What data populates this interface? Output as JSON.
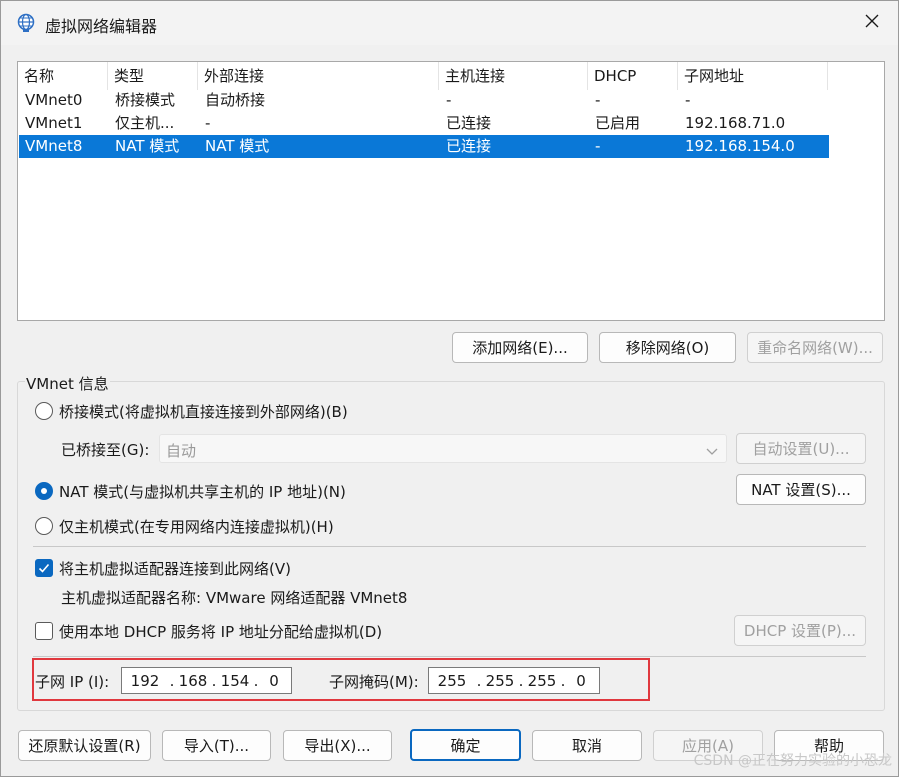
{
  "window": {
    "title": "虚拟网络编辑器",
    "title_icon": "globe-network-icon",
    "close_icon": "close-icon"
  },
  "network_list": {
    "columns": [
      "名称",
      "类型",
      "外部连接",
      "主机连接",
      "DHCP",
      "子网地址"
    ],
    "rows": [
      {
        "name": "VMnet0",
        "type": "桥接模式",
        "external": "自动桥接",
        "host": "-",
        "dhcp": "-",
        "subnet": "-",
        "selected": false
      },
      {
        "name": "VMnet1",
        "type": "仅主机...",
        "external": "-",
        "host": "已连接",
        "dhcp": "已启用",
        "subnet": "192.168.71.0",
        "selected": false
      },
      {
        "name": "VMnet8",
        "type": "NAT 模式",
        "external": "NAT 模式",
        "host": "已连接",
        "dhcp": "-",
        "subnet": "192.168.154.0",
        "selected": true
      }
    ]
  },
  "list_buttons": {
    "add": "添加网络(E)...",
    "remove": "移除网络(O)",
    "rename": "重命名网络(W)..."
  },
  "vmnet_info": {
    "group_label": "VMnet 信息",
    "bridged_radio": "桥接模式(将虚拟机直接连接到外部网络)(B)",
    "bridged_to_label": "已桥接至(G):",
    "bridged_to_value": "自动",
    "auto_settings_button": "自动设置(U)...",
    "nat_radio": "NAT 模式(与虚拟机共享主机的 IP 地址)(N)",
    "nat_settings_button": "NAT 设置(S)...",
    "host_only_radio": "仅主机模式(在专用网络内连接虚拟机)(H)",
    "selected_mode": "nat",
    "connect_adapter_checkbox": "将主机虚拟适配器连接到此网络(V)",
    "connect_adapter_checked": true,
    "adapter_name_text": "主机虚拟适配器名称: VMware 网络适配器 VMnet8",
    "dhcp_checkbox": "使用本地 DHCP 服务将 IP 地址分配给虚拟机(D)",
    "dhcp_checked": false,
    "dhcp_settings_button": "DHCP 设置(P)...",
    "subnet_ip_label": "子网 IP (I):",
    "subnet_ip": [
      "192",
      "168",
      "154",
      "0"
    ],
    "subnet_mask_label": "子网掩码(M):",
    "subnet_mask": [
      "255",
      "255",
      "255",
      "0"
    ]
  },
  "footer_buttons": {
    "restore": "还原默认设置(R)",
    "import": "导入(T)...",
    "export": "导出(X)...",
    "ok": "确定",
    "cancel": "取消",
    "apply": "应用(A)",
    "help": "帮助"
  },
  "watermark": "CSDN @正在努力实验的小恐龙",
  "colors": {
    "selection": "#0a78d7",
    "accent": "#0a68c0",
    "highlight_box": "#e0383e"
  }
}
